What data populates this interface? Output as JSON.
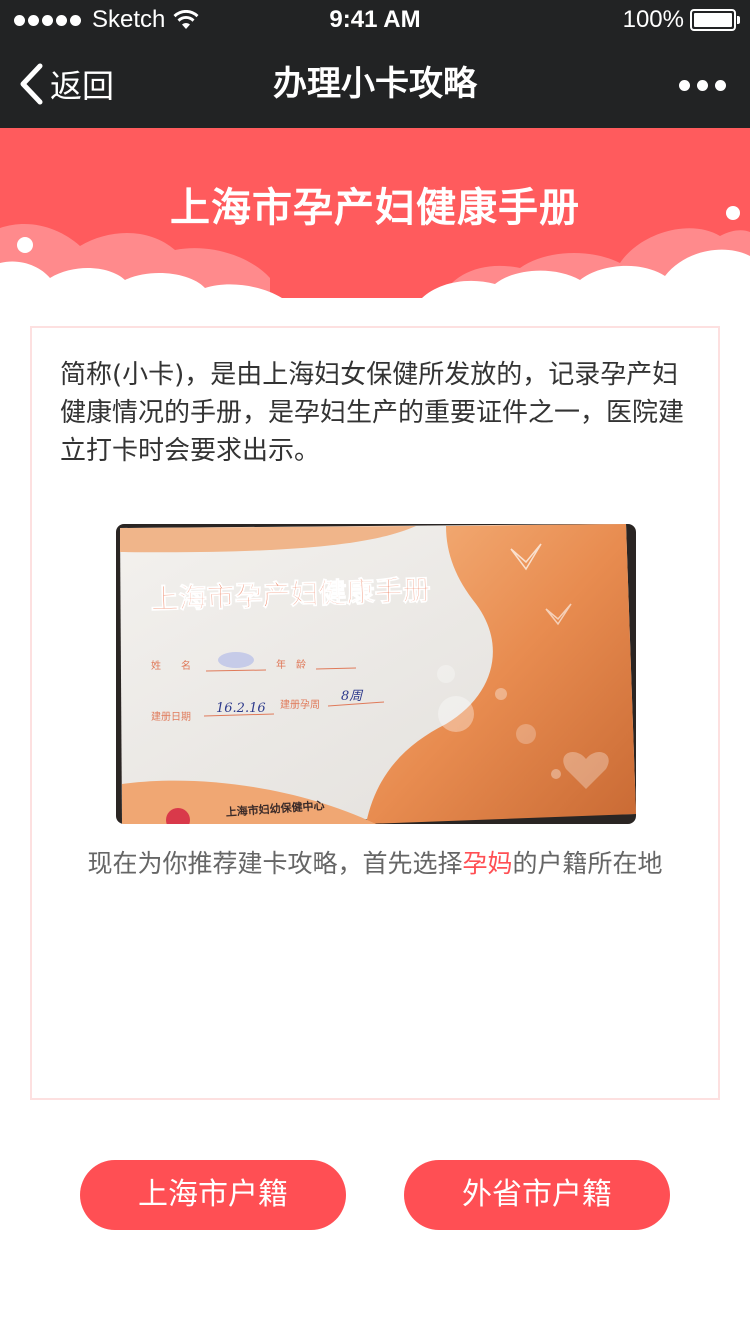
{
  "status_bar": {
    "carrier": "Sketch",
    "time": "9:41 AM",
    "battery_text": "100%",
    "battery_level": 1.0
  },
  "nav": {
    "back_label": "返回",
    "title": "办理小卡攻略"
  },
  "banner": {
    "title": "上海市孕产妇健康手册"
  },
  "card": {
    "intro": "简称(小卡)，是由上海妇女保健所发放的，记录孕产妇健康情况的手册，是孕妇生产的重要证件之一，医院建立打卡时会要求出示。",
    "photo": {
      "booklet_title": "上海市孕产妇健康手册",
      "name_label": "姓　　名",
      "age_label": "年　龄",
      "date_label": "建册日期",
      "date_value": "16.2.16",
      "week_label": "建册孕周",
      "week_value": "8周",
      "issuer": "上海市妇幼保健中心"
    },
    "recommend_before": "现在为你推荐建卡攻略，首先选择",
    "recommend_highlight": "孕妈",
    "recommend_after": "的户籍所在地"
  },
  "buttons": {
    "shanghai": "上海市户籍",
    "other": "外省市户籍"
  },
  "colors": {
    "nav_bg": "#222324",
    "banner_bg": "#ff5b5d",
    "accent": "#ff4f54",
    "card_border": "#fde0e0"
  }
}
